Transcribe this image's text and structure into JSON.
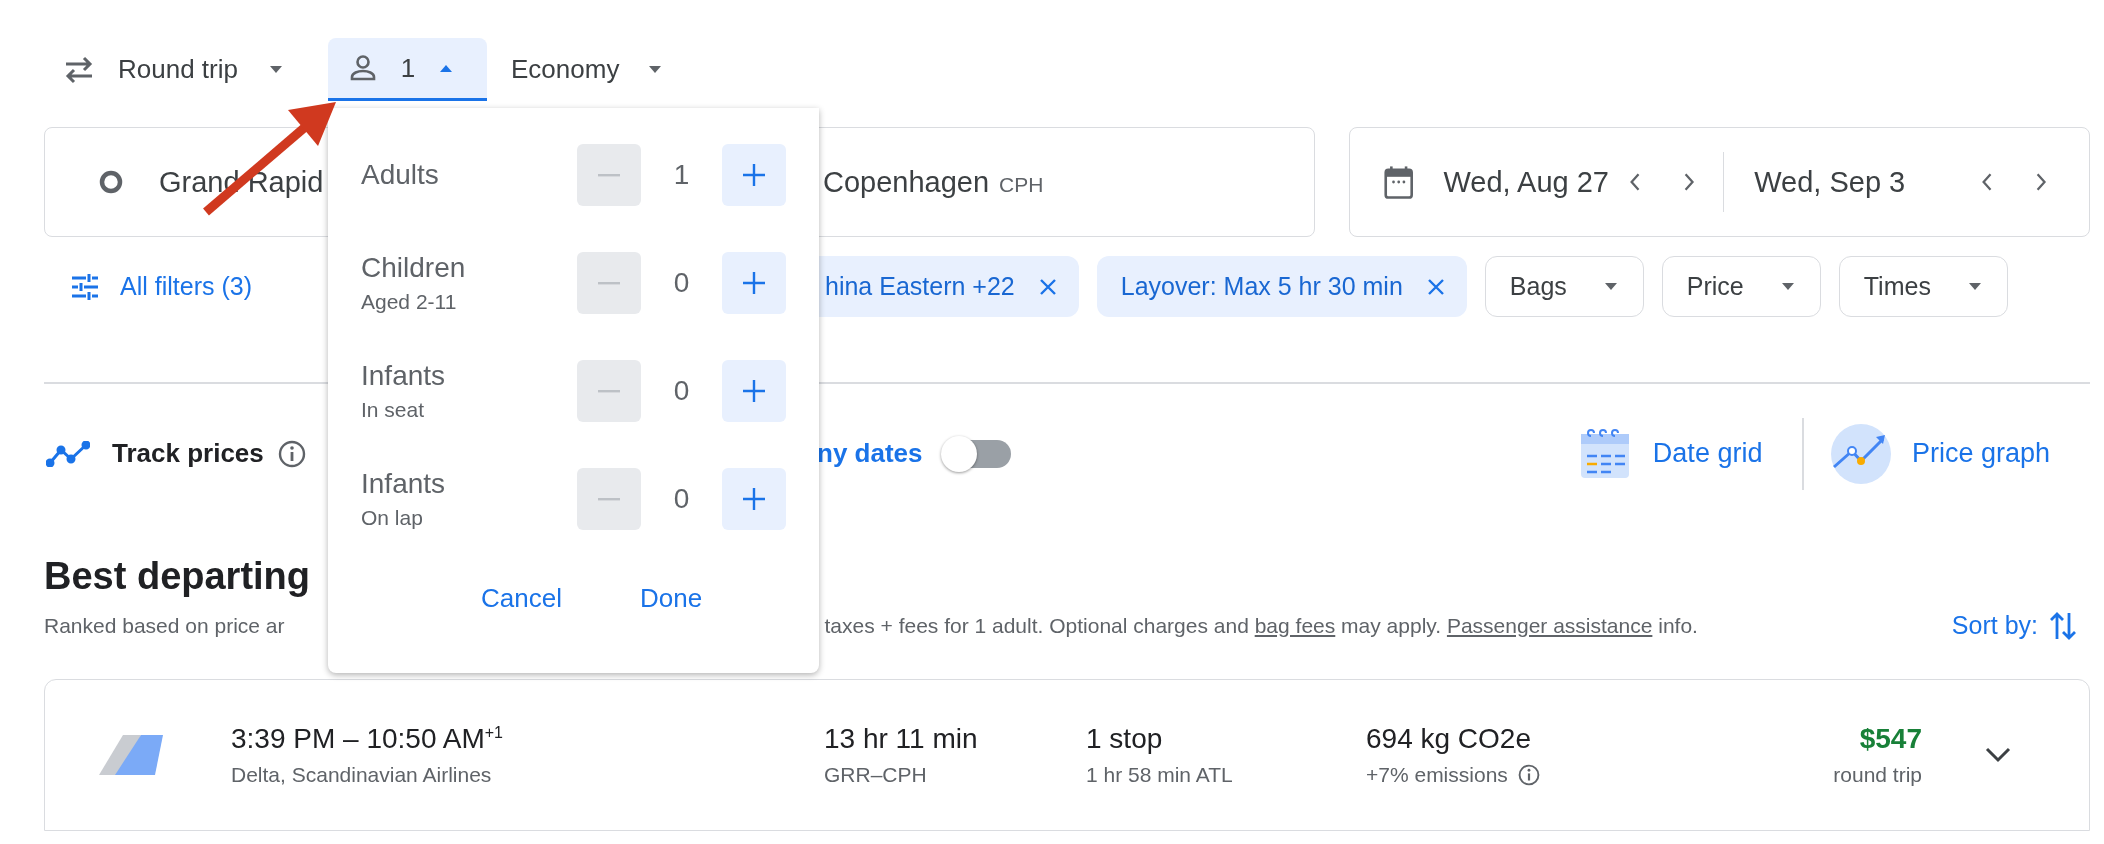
{
  "trip_bar": {
    "trip_type": "Round trip",
    "passengers": {
      "count": "1",
      "expanded": true
    },
    "cabin": "Economy"
  },
  "search": {
    "origin": "Grand Rapid",
    "destination": "Copenhagen",
    "destination_code": "CPH",
    "depart_date": "Wed, Aug 27",
    "return_date": "Wed, Sep 3"
  },
  "filters": {
    "all_filters": "All filters (3)",
    "chips": [
      {
        "label": "hina Eastern +22",
        "kind": "active"
      },
      {
        "label": "Layover: Max 5 hr 30 min",
        "kind": "active"
      },
      {
        "label": "Bags",
        "kind": "dropdown"
      },
      {
        "label": "Price",
        "kind": "dropdown"
      },
      {
        "label": "Times",
        "kind": "dropdown"
      }
    ]
  },
  "tools": {
    "track_prices": "Track prices",
    "any_dates": "ny dates",
    "any_dates_on": false,
    "date_grid": "Date grid",
    "price_graph": "Price graph"
  },
  "results": {
    "heading": "Best departing",
    "note_left": "Ranked based on price ar",
    "note_right": [
      {
        "text": "taxes + fees for 1 adult. Optional charges and ",
        "link": false
      },
      {
        "text": "bag fees",
        "link": true
      },
      {
        "text": " may apply. ",
        "link": false
      },
      {
        "text": "Passenger assistance",
        "link": true
      },
      {
        "text": " info.",
        "link": false
      }
    ],
    "sort_label": "Sort by:",
    "flights": [
      {
        "times": "3:39 PM – 10:50 AM$^{+1}$",
        "airlines": "Delta, Scandinavian Airlines",
        "duration": "13 hr 11 min",
        "route": "GRR–CPH",
        "stops": "1 stop",
        "layover": "1 hr 58 min ATL",
        "emissions": "694 kg CO2e",
        "emissions_delta": "+7% emissions",
        "price": "$547",
        "price_note": "round trip"
      }
    ]
  },
  "passenger_popup": {
    "rows": [
      {
        "label": "Adults",
        "value": "1",
        "minus_disabled": true
      },
      {
        "label": "Children",
        "sublabel": "Aged 2-11",
        "value": "0",
        "minus_disabled": true
      },
      {
        "label": "Infants",
        "sublabel": "In seat",
        "value": "0",
        "minus_disabled": true
      },
      {
        "label": "Infants",
        "sublabel": "On lap",
        "value": "0",
        "minus_disabled": true
      }
    ],
    "cancel": "Cancel",
    "done": "Done"
  }
}
